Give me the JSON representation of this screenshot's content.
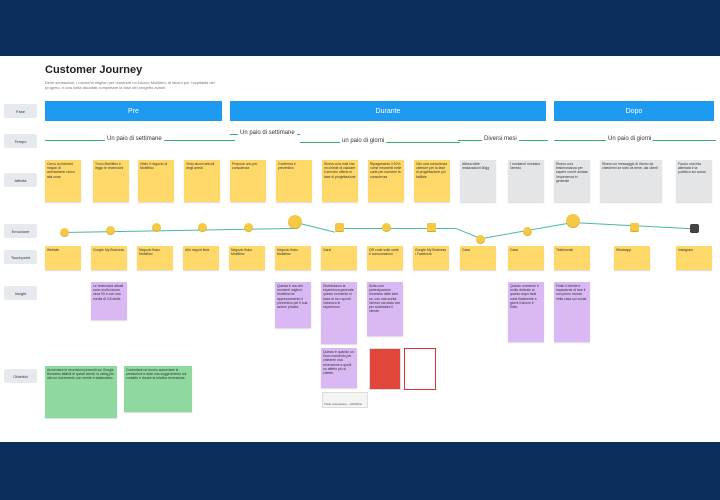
{
  "board": {
    "title": "Customer Journey",
    "subtitle": "Delle sensazioni, i momenti migliori per mostrare un Nuovo Mobiltino di lavoro per l'ospitalità del progetto, e una volta ascoltati completare la fase del progetto avanti."
  },
  "rows": {
    "fase": "Fase",
    "tempo": "Tempo",
    "attivita": "Attività",
    "emozione": "Emozione",
    "touchpoint": "Touchpoint",
    "insight": "Insight",
    "obiettivi": "Obiettivi"
  },
  "phases": {
    "pre": "Pre",
    "durante": "Durante",
    "dopo": "Dopo"
  },
  "timeline": {
    "t1": "Un paio di settimane",
    "t2": "Un paio di settimane",
    "t3": "un paio di giorni",
    "t4": "Diversi mesi",
    "t5": "Un paio di giorni"
  },
  "activities": [
    "Cerco su internet negozi di arredamenti vicino alla zona",
    "Trovo Mobiltino e leggo le recensioni",
    "Visito il negozio di Mobiltino",
    "Vedo alcuni articoli degli arredi",
    "Propone uno per consulenza",
    "Conferma e preventivo",
    "Ricevo una mail che mi chiede di valutare il servizio offerto in fase di progettazione",
    "Ripagamento il 30% come rimanenti nelle carte per iscrivere la consulenza",
    "Giro una consulenza ulteriore per la fase di progettazione più fattibile",
    "Attesa delle realizzazioni 60gg",
    "I montatori montano l'arredo",
    "Ricevo una testimonianza per sapere com'è andata l'esperienza in generale",
    "Ricevo un messaggio di ritorno da chiedermi se tutto va bene, dai clienti",
    "Faccio una foto allentata e la pubblico sui social"
  ],
  "touchpoints": [
    "Website",
    "Google My Business",
    "Negozio fisico Mobiltino",
    "Altri negozi fisici",
    "Negozio fisico Mobiltino",
    "Negozio fisico Mobiltino",
    "Garzi",
    "QR code sulle carte e consumazioni",
    "Google My Business / Facebook",
    "Casa",
    "Casa",
    "Testimonial",
    "Whatsapp",
    "Instagram"
  ],
  "insights": [
    "Le recensioni attuali sono molto buone circa 90 e con una media di 4,8 stelle.",
    "Questa è uno dei momenti migliori. Mobiltino fa apprezzamento il preventivo per il sua azione privata.",
    "Distribuiamo la esperienza generale questo momento in base ai loro spunti. Valorizzo le esperienze.",
    "Sulla com partecipazione recensito dalle idee se, con una scelta l'arredo sia stato con per soddisfare il cliente.",
    "Questo momento è molto delicato la quanto dopo tanti mesi finalmente a giorni il lavoro è finito.",
    "Finito il cliente è impaziente di fare il suo primo ricordo nella casa sui social."
  ],
  "extra_insight": "Questo è quando un buon momento per chiedere una recensione a quelli un affetto più si chiede.",
  "objectives": [
    "Aumentare le recensioni presenti sul Google Business fattibili di questi clienti, la rating più alto un incremento con mente e sistematico.",
    "Controllare un buono aumentare le prestazioni e dare una suggerimento sul contatto e durare la relativa recensione."
  ],
  "thumb_caption": "Titolo recensione – Mobiltino"
}
